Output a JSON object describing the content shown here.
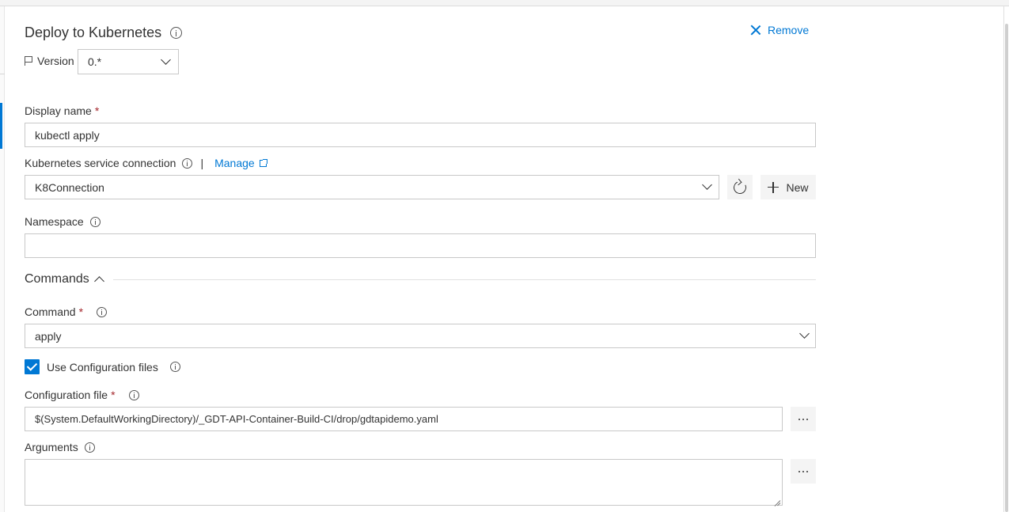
{
  "task": {
    "title": "Deploy to Kubernetes",
    "remove_label": "Remove",
    "version_label": "Version",
    "version_value": "0.*"
  },
  "fields": {
    "display_name": {
      "label": "Display name",
      "required_mark": "*",
      "value": "kubectl apply"
    },
    "service_connection": {
      "label": "Kubernetes service connection",
      "separator": "|",
      "manage_label": "Manage",
      "value": "K8Connection",
      "new_label": "New"
    },
    "namespace": {
      "label": "Namespace",
      "value": ""
    },
    "commands_section": {
      "title": "Commands"
    },
    "command": {
      "label": "Command",
      "required_mark": "*",
      "value": "apply"
    },
    "use_config_files": {
      "label": "Use Configuration files",
      "checked": true
    },
    "config_file": {
      "label": "Configuration file",
      "required_mark": "*",
      "value": "$(System.DefaultWorkingDirectory)/_GDT-API-Container-Build-CI/drop/gdtapidemo.yaml"
    },
    "arguments": {
      "label": "Arguments",
      "value": ""
    }
  },
  "colors": {
    "accent": "#0078d4",
    "required": "#a4262c",
    "border": "#c8c8c8"
  },
  "icons": [
    "info-icon",
    "close-icon",
    "flag-icon",
    "chevron-down-icon",
    "external-link-icon",
    "refresh-icon",
    "plus-icon",
    "chevron-up-icon",
    "checkmark-icon",
    "ellipsis-icon"
  ]
}
